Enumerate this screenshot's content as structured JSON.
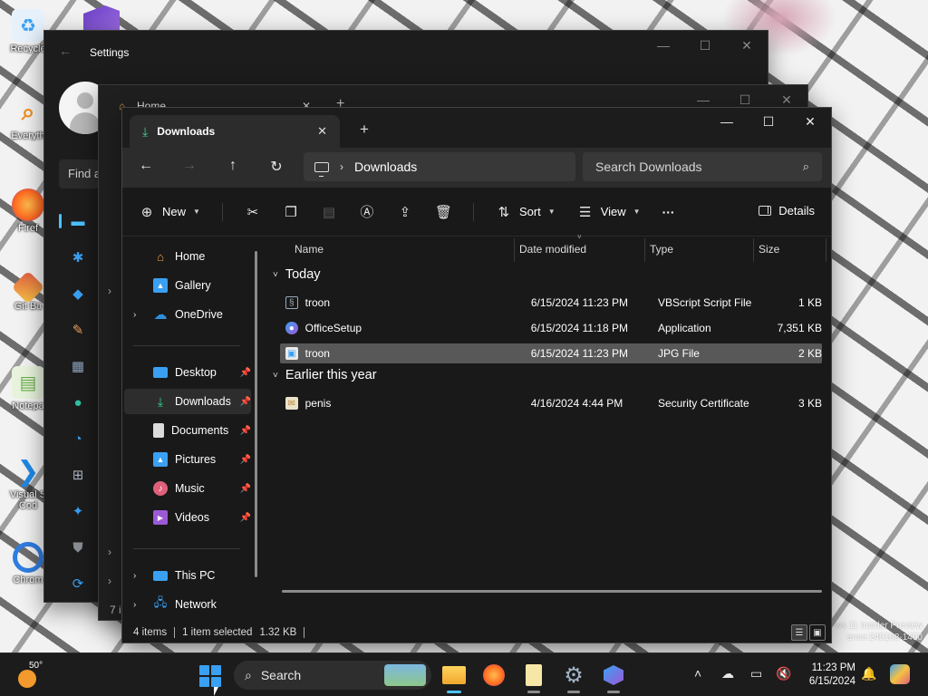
{
  "desktop": {
    "icons": [
      {
        "label": "Recycle",
        "icon": "recycle-bin-icon",
        "color": "#3aa0f3"
      },
      {
        "label": "Everyth",
        "icon": "everything-search-icon",
        "color": "#f28c1a"
      },
      {
        "label": "Firef",
        "icon": "firefox-icon",
        "color": "#ff6a1f"
      },
      {
        "label": "Git Ba",
        "icon": "git-bash-icon",
        "color": "#e05d44"
      },
      {
        "label": "Notepa",
        "icon": "notepad-icon",
        "color": "#6ab04c"
      },
      {
        "label": "Visual S Cod",
        "icon": "vscode-icon",
        "color": "#1e88e5"
      },
      {
        "label": "Chrom",
        "icon": "chrome-icon",
        "color": "#2f7de1"
      }
    ],
    "watermark_line1": "ws 11 Insider Preview",
    "watermark_line2": "ense:240108-1400"
  },
  "settings_window": {
    "title": "Settings",
    "search_placeholder": "Find a"
  },
  "explorer_back": {
    "tab_label": "Home",
    "footer_text": "7 i"
  },
  "explorer": {
    "tab_label": "Downloads",
    "address_location": "Downloads",
    "search_placeholder": "Search Downloads",
    "commands": {
      "new": "New",
      "sort": "Sort",
      "view": "View",
      "more": "···",
      "details": "Details"
    },
    "sidebar": {
      "top": [
        {
          "label": "Home",
          "icon": "home-icon",
          "color": "#f0a24a"
        },
        {
          "label": "Gallery",
          "icon": "gallery-icon",
          "color": "#3aa0f3"
        },
        {
          "label": "OneDrive",
          "icon": "onedrive-icon",
          "color": "#2f8fe0"
        }
      ],
      "quick_access": [
        {
          "label": "Desktop",
          "icon": "desktop-icon",
          "color": "#3aa0f3"
        },
        {
          "label": "Downloads",
          "icon": "downloads-icon",
          "color": "#3ccf91"
        },
        {
          "label": "Documents",
          "icon": "documents-icon",
          "color": "#dcdcdc"
        },
        {
          "label": "Pictures",
          "icon": "pictures-icon",
          "color": "#3aa0f3"
        },
        {
          "label": "Music",
          "icon": "music-icon",
          "color": "#e0607a"
        },
        {
          "label": "Videos",
          "icon": "videos-icon",
          "color": "#9b59d6"
        }
      ],
      "bottom": [
        {
          "label": "This PC",
          "icon": "this-pc-icon",
          "color": "#3aa0f3"
        },
        {
          "label": "Network",
          "icon": "network-icon",
          "color": "#3aa0f3"
        }
      ]
    },
    "columns": {
      "name": "Name",
      "date": "Date modified",
      "type": "Type",
      "size": "Size"
    },
    "groups": [
      {
        "label": "Today",
        "files": [
          {
            "name": "troon",
            "date": "6/15/2024 11:23 PM",
            "type": "VBScript Script File",
            "size": "1 KB",
            "icon": "vbscript-file-icon"
          },
          {
            "name": "OfficeSetup",
            "date": "6/15/2024 11:18 PM",
            "type": "Application",
            "size": "7,351 KB",
            "icon": "office-setup-icon"
          },
          {
            "name": "troon",
            "date": "6/15/2024 11:23 PM",
            "type": "JPG File",
            "size": "2 KB",
            "icon": "jpg-file-icon",
            "selected": true
          }
        ]
      },
      {
        "label": "Earlier this year",
        "files": [
          {
            "name": "penis",
            "date": "4/16/2024 4:44 PM",
            "type": "Security Certificate",
            "size": "3 KB",
            "icon": "certificate-file-icon"
          }
        ]
      }
    ],
    "status": {
      "count": "4 items",
      "selection": "1 item selected",
      "size": "1.32 KB"
    }
  },
  "taskbar": {
    "weather_temp": "50°",
    "search_label": "Search",
    "apps": [
      "file-explorer-icon",
      "firefox-icon",
      "notepad-icon",
      "settings-gear-icon",
      "copilot-icon"
    ],
    "clock_time": "11:23 PM",
    "clock_date": "6/15/2024"
  },
  "colors": {
    "accent": "#4cc2ff",
    "window_bg": "#191919",
    "selection": "#585858"
  }
}
